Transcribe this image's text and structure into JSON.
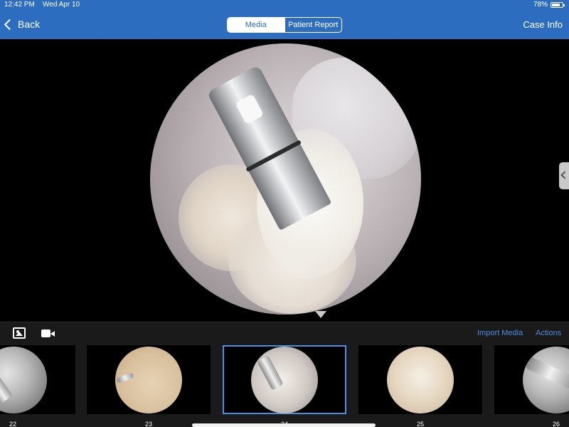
{
  "status_bar": {
    "time": "12:42 PM",
    "date": "Wed Apr 10",
    "battery_percent": "78%",
    "battery_level": 0.78
  },
  "nav": {
    "back_label": "Back",
    "segments": [
      "Media",
      "Patient Report"
    ],
    "active_segment": "Media",
    "right_button": "Case Info"
  },
  "toolbar": {
    "import_label": "Import Media",
    "actions_label": "Actions"
  },
  "thumbnails": [
    {
      "label": "22",
      "selected": false
    },
    {
      "label": "23",
      "selected": false
    },
    {
      "label": "24",
      "selected": true
    },
    {
      "label": "25",
      "selected": false
    },
    {
      "label": "26",
      "selected": false
    }
  ],
  "colors": {
    "header_blue": "#2c6dbf",
    "accent_blue": "#4a90e2",
    "toolbar_bg": "#1a1a1a"
  }
}
